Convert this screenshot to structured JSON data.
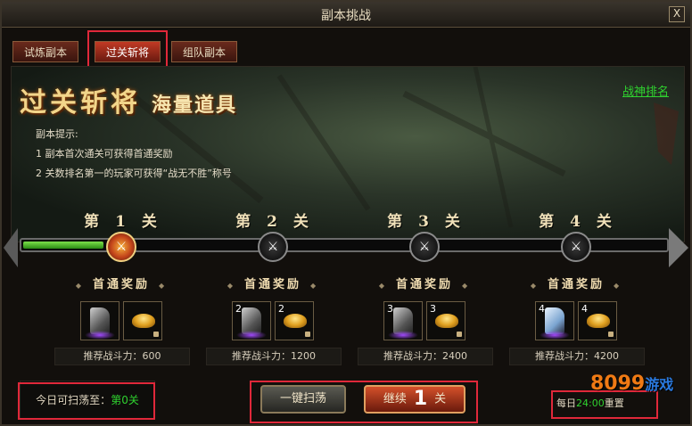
{
  "window": {
    "title": "副本挑战",
    "close_label": "X"
  },
  "tabs": [
    {
      "label": "试炼副本",
      "active": false
    },
    {
      "label": "过关斩将",
      "active": true
    },
    {
      "label": "组队副本",
      "active": false
    }
  ],
  "banner": {
    "heading": "过关斩将",
    "subheading": "海量道具",
    "rank_link": "战神排名",
    "tips_title": "副本提示:",
    "tips": [
      "1  副本首次通关可获得首通奖励",
      "2  关数排名第一的玩家可获得“战无不胜”称号"
    ]
  },
  "progress": {
    "fraction": 0.125
  },
  "stages": [
    {
      "label": "第 1 关",
      "state": "cleared",
      "reward_title": "首通奖励",
      "item1_count": "",
      "item2_count": "",
      "power_text": "推荐战斗力：600"
    },
    {
      "label": "第 2 关",
      "state": "locked",
      "reward_title": "首通奖励",
      "item1_count": "2",
      "item2_count": "2",
      "power_text": "推荐战斗力：1200"
    },
    {
      "label": "第 3 关",
      "state": "locked",
      "reward_title": "首通奖励",
      "item1_count": "3",
      "item2_count": "3",
      "power_text": "推荐战斗力：2400"
    },
    {
      "label": "第 4 关",
      "state": "locked",
      "reward_title": "首通奖励",
      "item1_count": "4",
      "item2_count": "4",
      "power_text": "推荐战斗力：4200"
    }
  ],
  "footer": {
    "scan_label": "今日可扫荡至：",
    "scan_value": "第0关",
    "sweep_button": "一键扫荡",
    "continue_label": "继续",
    "continue_number": "1",
    "continue_suffix": "关",
    "daily_prefix": "每日",
    "daily_hour": "24:00",
    "daily_suffix": "重置"
  },
  "watermark": {
    "text": "8099",
    "suffix": "游戏"
  },
  "colors": {
    "accent_green": "#2fd22f",
    "highlight_red": "#e0283a",
    "gold": "#f2d58a"
  }
}
